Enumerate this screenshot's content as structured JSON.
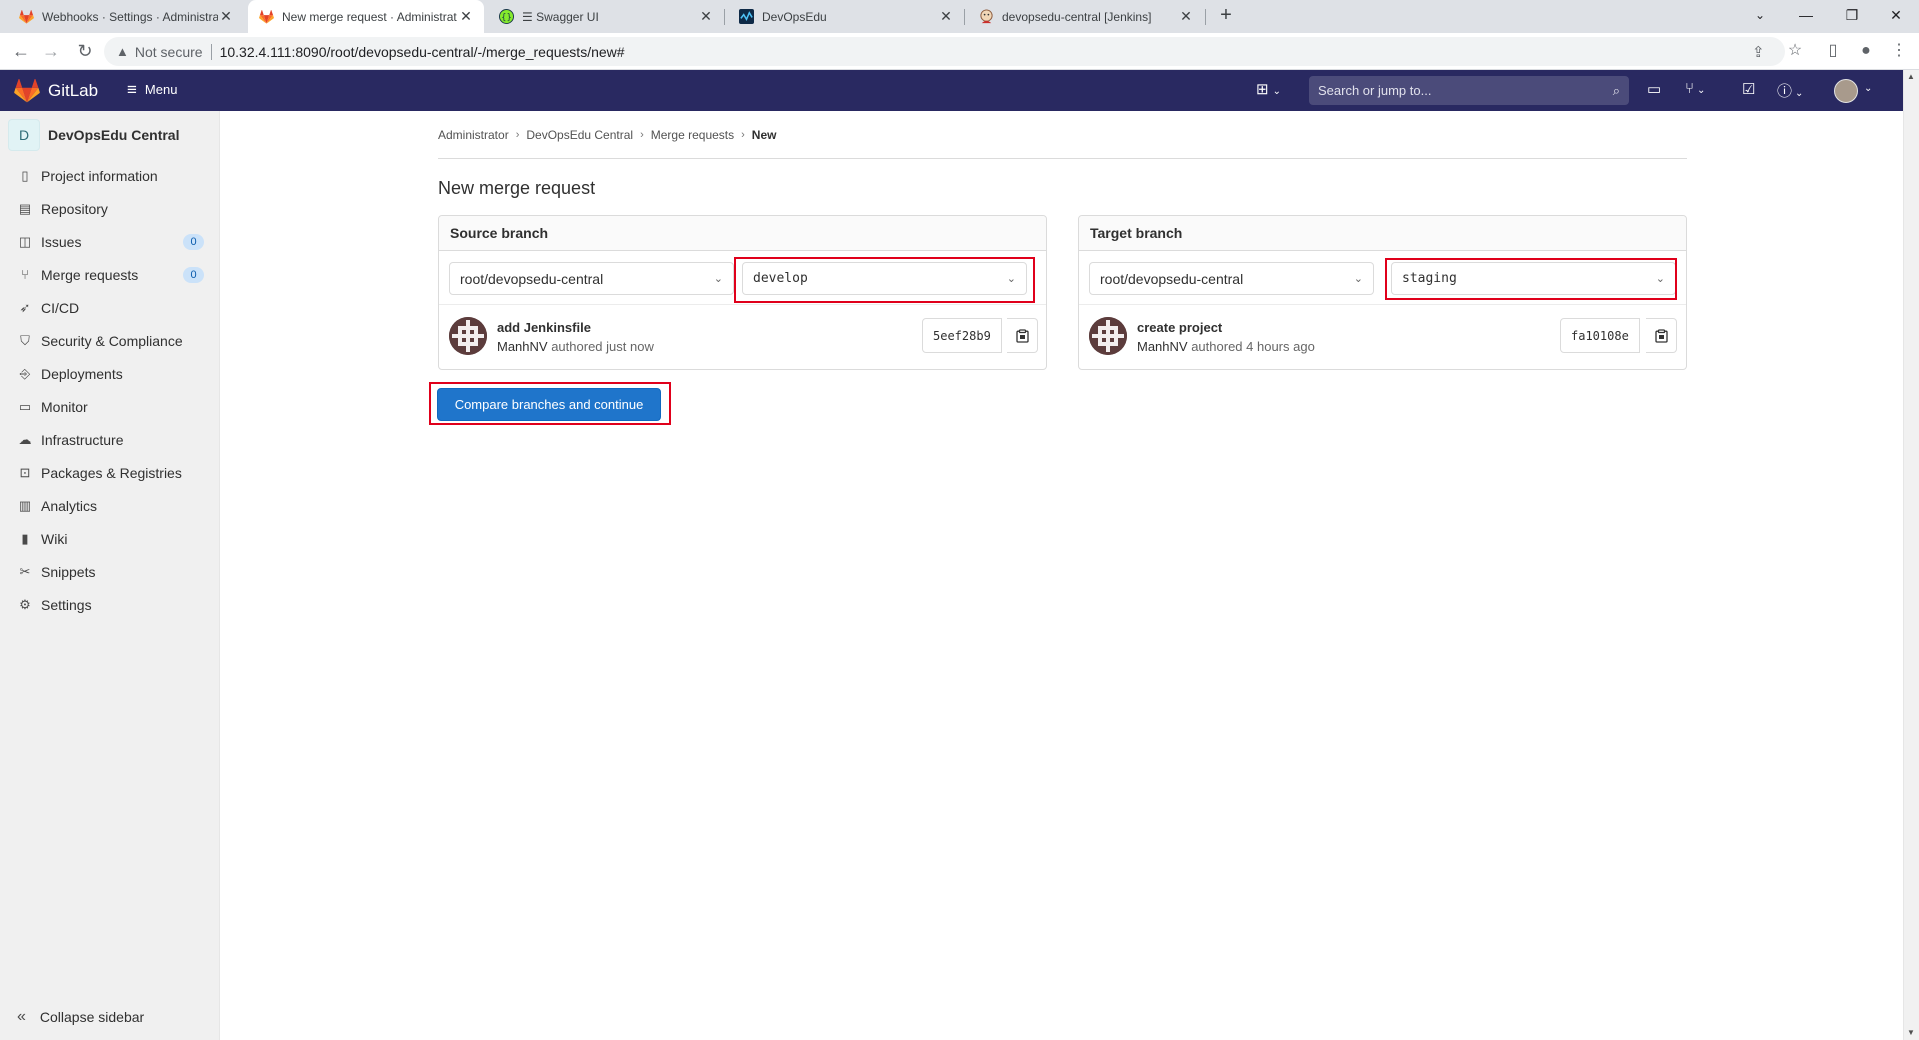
{
  "browser": {
    "tabs": [
      {
        "title": "Webhooks · Settings · Administrat",
        "icon": "gitlab-icon"
      },
      {
        "title": "New merge request · Administrat",
        "icon": "gitlab-icon",
        "active": true
      },
      {
        "title": "Swagger UI",
        "icon": "swagger-icon"
      },
      {
        "title": "DevOpsEdu",
        "icon": "devopsedu-icon"
      },
      {
        "title": "devopsedu-central [Jenkins]",
        "icon": "jenkins-icon"
      }
    ],
    "security_label": "Not secure",
    "url": "10.32.4.111:8090/root/devopsedu-central/-/merge_requests/new#"
  },
  "header": {
    "brand": "GitLab",
    "menu_label": "Menu",
    "search_placeholder": "Search or jump to..."
  },
  "sidebar": {
    "project_initial": "D",
    "project_name": "DevOpsEdu Central",
    "items": [
      {
        "label": "Project information",
        "icon": "project-info-icon"
      },
      {
        "label": "Repository",
        "icon": "repository-icon"
      },
      {
        "label": "Issues",
        "icon": "issues-icon",
        "badge": "0"
      },
      {
        "label": "Merge requests",
        "icon": "merge-request-icon",
        "badge": "0"
      },
      {
        "label": "CI/CD",
        "icon": "rocket-icon"
      },
      {
        "label": "Security & Compliance",
        "icon": "shield-icon"
      },
      {
        "label": "Deployments",
        "icon": "deployments-icon"
      },
      {
        "label": "Monitor",
        "icon": "monitor-icon"
      },
      {
        "label": "Infrastructure",
        "icon": "cloud-icon"
      },
      {
        "label": "Packages & Registries",
        "icon": "package-icon"
      },
      {
        "label": "Analytics",
        "icon": "chart-icon"
      },
      {
        "label": "Wiki",
        "icon": "book-icon"
      },
      {
        "label": "Snippets",
        "icon": "scissors-icon"
      },
      {
        "label": "Settings",
        "icon": "gear-icon"
      }
    ],
    "collapse_label": "Collapse sidebar"
  },
  "breadcrumb": {
    "items": [
      "Administrator",
      "DevOpsEdu Central",
      "Merge requests"
    ],
    "current": "New"
  },
  "page_title": "New merge request",
  "source": {
    "heading": "Source branch",
    "project": "root/devopsedu-central",
    "branch": "develop",
    "commit_message": "add Jenkinsfile",
    "author": "ManhNV",
    "authored_text": "authored just now",
    "sha": "5eef28b9"
  },
  "target": {
    "heading": "Target branch",
    "project": "root/devopsedu-central",
    "branch": "staging",
    "commit_message": "create project",
    "author": "ManhNV",
    "authored_text": "authored 4 hours ago",
    "sha": "fa10108e"
  },
  "compare_button": "Compare branches and continue",
  "colors": {
    "header_bg": "#292961",
    "primary": "#1f75cb",
    "highlight": "#e0001b"
  }
}
